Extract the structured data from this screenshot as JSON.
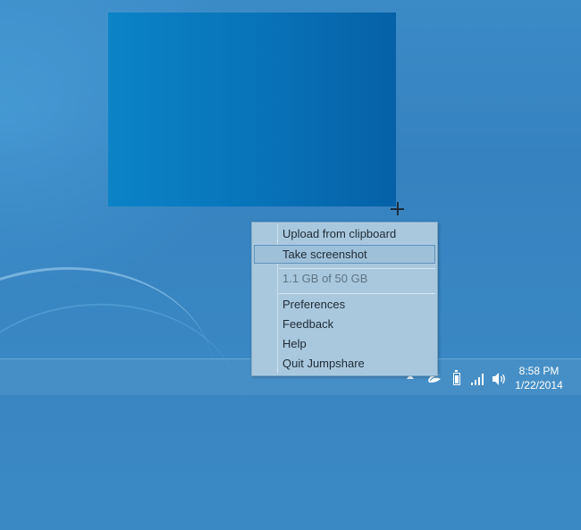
{
  "context_menu": {
    "items": [
      {
        "label": "Upload from clipboard",
        "state": "normal"
      },
      {
        "label": "Take screenshot",
        "state": "highlighted"
      },
      {
        "label": "1.1 GB of 50 GB",
        "state": "disabled"
      },
      {
        "label": "Preferences",
        "state": "normal"
      },
      {
        "label": "Feedback",
        "state": "normal"
      },
      {
        "label": "Help",
        "state": "normal"
      },
      {
        "label": "Quit Jumpshare",
        "state": "normal"
      }
    ]
  },
  "taskbar": {
    "tray_icons": [
      "show-hidden-icons-arrow-icon",
      "jumpshare-icon",
      "battery-icon",
      "network-signal-icon",
      "volume-icon"
    ],
    "clock": {
      "time": "8:58 PM",
      "date": "1/22/2014"
    }
  },
  "colors": {
    "desktop": "#3a88c4",
    "capture_region": "#0874b9",
    "menu_background": "#a9c8de",
    "menu_highlight_border": "#5f93bd"
  }
}
